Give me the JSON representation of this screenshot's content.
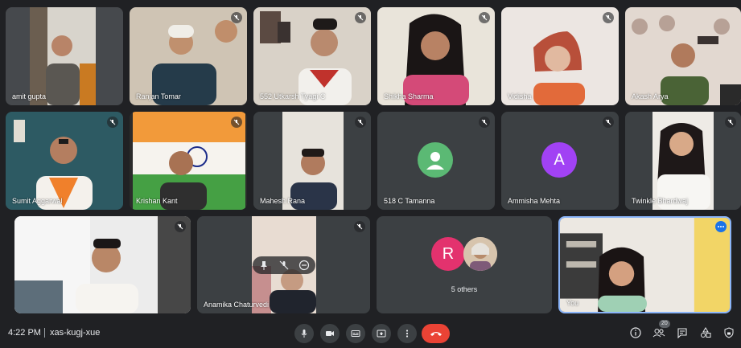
{
  "participants": [
    {
      "name": "amit gupta"
    },
    {
      "name": "Ranjan Tomar"
    },
    {
      "name": "552 Utkarsh Tyagi C"
    },
    {
      "name": "Shikha Sharma"
    },
    {
      "name": "Vidisha"
    },
    {
      "name": "Akash Arya"
    },
    {
      "name": "Sumit Aggarwal"
    },
    {
      "name": "Krishan Kant"
    },
    {
      "name": "Mahesh Rana"
    },
    {
      "name": "518 C Tamanna"
    },
    {
      "name": "Ammisha Mehta",
      "initial": "A"
    },
    {
      "name": "Twinkle Bhardwaj"
    },
    {
      "name": ""
    },
    {
      "name": "Anamika Chaturvedi"
    },
    {
      "name": "You"
    }
  ],
  "others_tile": {
    "label": "5 others",
    "initial": "R"
  },
  "toolbar": {
    "time": "4:22 PM",
    "meeting_code": "xas-kugj-xue",
    "people_count": "20"
  },
  "colors": {
    "tile_bg": "#3c4043",
    "page_bg": "#202124",
    "hangup": "#ea4335",
    "avatar_green": "#5bb974",
    "avatar_purple": "#a142f4",
    "avatar_pink": "#e3326e"
  }
}
